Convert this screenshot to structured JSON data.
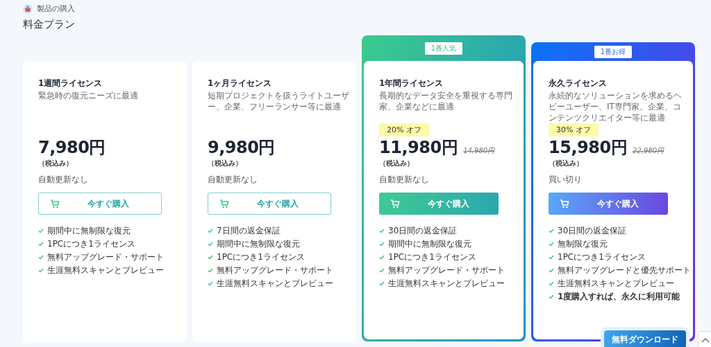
{
  "breadcrumb": "製品の購入",
  "title": "料金プラン",
  "plans": [
    {
      "kind": "plain",
      "name": "1週間ライセンス",
      "description": "緊急時の復元ニーズに最適",
      "price": "7,980円",
      "tax": "（税込み）",
      "renewal": "自動更新なし",
      "button": "今すぐ購入",
      "features": [
        {
          "text": "期間中に無制限な復元",
          "bold": false
        },
        {
          "text": "1PCにつき1ライセンス",
          "bold": false
        },
        {
          "text": "無料アップグレード・サポート",
          "bold": false
        },
        {
          "text": "生涯無料スキャンとプレビュー",
          "bold": false
        }
      ]
    },
    {
      "kind": "plain",
      "name": "1ヶ月ライセンス",
      "description": "短期プロジェクトを扱うライトユーザー、企業、フリーランサー等に最適",
      "price": "9,980円",
      "tax": "（税込み）",
      "renewal": "自動更新なし",
      "button": "今すぐ購入",
      "features": [
        {
          "text": "7日間の返金保証",
          "bold": false
        },
        {
          "text": "期間中に無制限な復元",
          "bold": false
        },
        {
          "text": "1PCにつき1ライセンス",
          "bold": false
        },
        {
          "text": "無料アップグレード・サポート",
          "bold": false
        },
        {
          "text": "生涯無料スキャンとプレビュー",
          "bold": false
        }
      ]
    },
    {
      "kind": "green",
      "badge": "1番人気",
      "name": "1年間ライセンス",
      "description": "長期的なデータ安全を重視する専門家、企業などに最適",
      "discount": "20% オフ",
      "price": "11,980円",
      "old_price": "14,980円",
      "tax": "（税込み）",
      "renewal": "自動更新なし",
      "button": "今すぐ購入",
      "features": [
        {
          "text": "30日間の返金保証",
          "bold": false
        },
        {
          "text": "期間中に無制限な復元",
          "bold": false
        },
        {
          "text": "1PCにつき1ライセンス",
          "bold": false
        },
        {
          "text": "無料アップグレード・サポート",
          "bold": false
        },
        {
          "text": "生涯無料スキャンとプレビュー",
          "bold": false
        }
      ]
    },
    {
      "kind": "blue",
      "badge": "1番お得",
      "name": "永久ライセンス",
      "description": "永続的なソリューションを求めるヘビーユーザー、IT専門家、企業、コンテンツクリエイター等に最適",
      "discount": "30% オフ",
      "price": "15,980円",
      "old_price": "22,980円",
      "tax": "（税込み）",
      "renewal": "買い切り",
      "button": "今すぐ購入",
      "features": [
        {
          "text": "30日間の返金保証",
          "bold": false
        },
        {
          "text": "無制限な復元",
          "bold": false
        },
        {
          "text": "1PCにつき1ライセンス",
          "bold": false
        },
        {
          "text": "無料アップグレードと優先サポート",
          "bold": false
        },
        {
          "text": "生涯無料スキャンとプレビュー",
          "bold": false
        },
        {
          "text": "1度購入すれば、永久に利用可能",
          "bold": true
        }
      ]
    }
  ],
  "download_button": "無料ダウンロード"
}
